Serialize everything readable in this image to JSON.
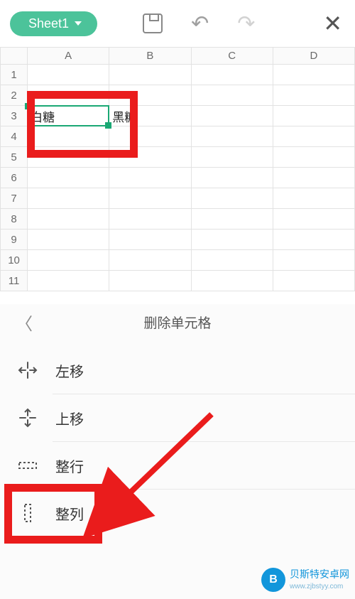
{
  "toolbar": {
    "sheet_name": "Sheet1"
  },
  "grid": {
    "columns": [
      "A",
      "B",
      "C",
      "D"
    ],
    "rows": [
      "1",
      "2",
      "3",
      "4",
      "5",
      "6",
      "7",
      "8",
      "9",
      "10",
      "11"
    ],
    "cells": {
      "A3": "白糖",
      "B3": "黑糖"
    }
  },
  "panel": {
    "title": "删除单元格",
    "options": {
      "shift_left": "左移",
      "shift_up": "上移",
      "entire_row": "整行",
      "entire_col": "整列"
    }
  },
  "watermark": {
    "name": "贝斯特安卓网",
    "url": "www.zjbstyy.com"
  }
}
